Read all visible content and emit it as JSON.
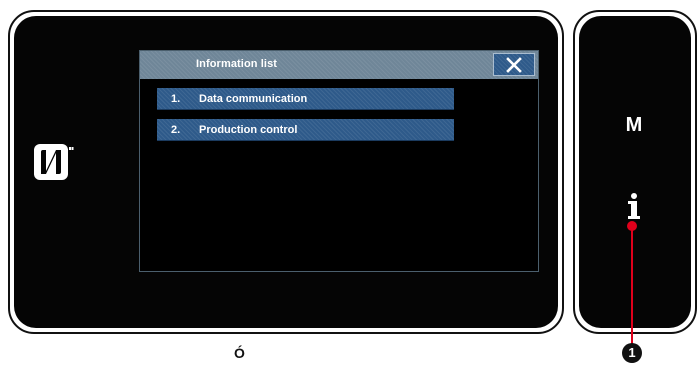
{
  "dialog": {
    "title": "Information list",
    "close_icon": "close-icon",
    "items": [
      {
        "number": "1.",
        "label": "Data communication"
      },
      {
        "number": "2.",
        "label": "Production control"
      }
    ]
  },
  "side_panel": {
    "m_key_label": "M",
    "info_icon": "info-icon"
  },
  "nfc_icon": "nfc-icon",
  "callout": {
    "badge": "1"
  },
  "stray_mark": "Ó",
  "colors": {
    "bezel": "#050505",
    "titlebar": "#6f8698",
    "button": "#2e5a8a",
    "callout": "#e0001b"
  }
}
